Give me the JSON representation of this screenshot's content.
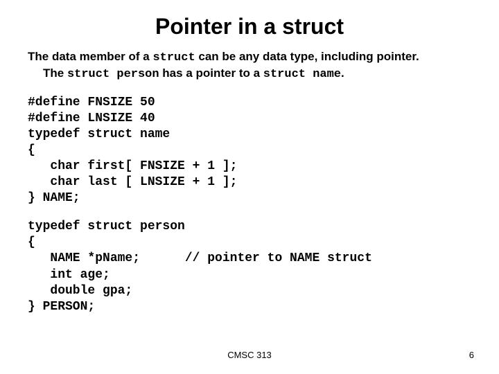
{
  "title": "Pointer in a struct",
  "desc": {
    "line1_a": "The data member of a ",
    "line1_struct": "struct",
    "line1_b": " can be any data type, including pointer.",
    "line2_a": "The ",
    "line2_struct1": "struct person",
    "line2_b": " has a pointer to a ",
    "line2_struct2": "struct name",
    "line2_c": "."
  },
  "code_block1": "#define FNSIZE 50\n#define LNSIZE 40\ntypedef struct name\n{\n   char first[ FNSIZE + 1 ];\n   char last [ LNSIZE + 1 ];\n} NAME;",
  "code_block2": "typedef struct person\n{\n   NAME *pName;      // pointer to NAME struct\n   int age;\n   double gpa;\n} PERSON;",
  "footer_center": "CMSC 313",
  "footer_right": "6"
}
